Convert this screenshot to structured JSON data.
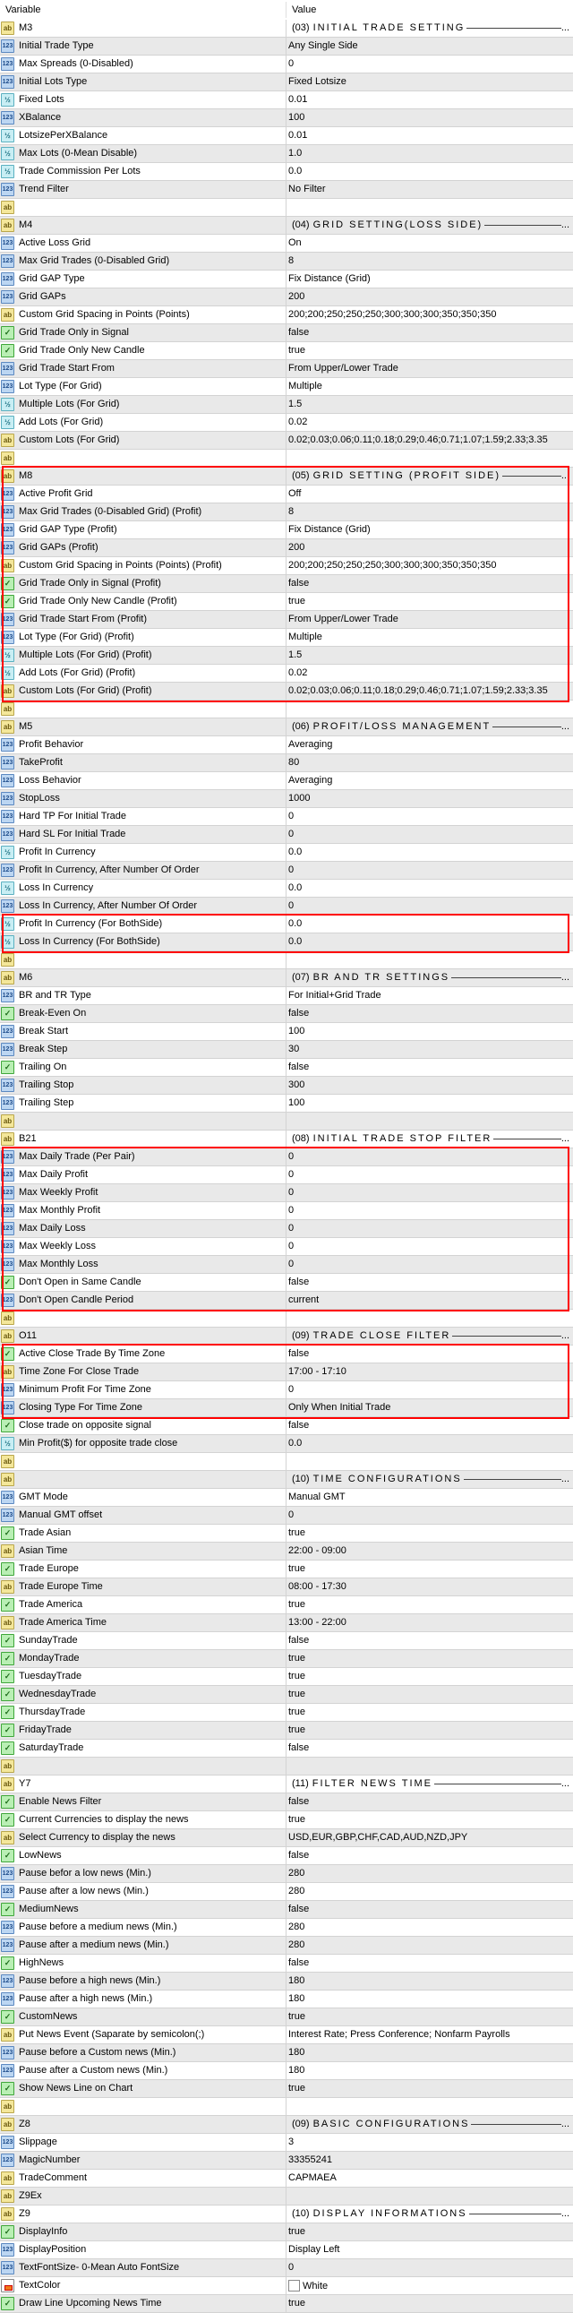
{
  "header": {
    "variable": "Variable",
    "value": "Value"
  },
  "rows": [
    {
      "t": "ab",
      "n": "M3",
      "code": "(03)",
      "title": "INITIAL TRADE SETTING"
    },
    {
      "t": "int",
      "n": "Initial Trade Type",
      "v": "Any Single Side"
    },
    {
      "t": "int",
      "n": "Max Spreads (0-Disabled)",
      "v": "0"
    },
    {
      "t": "int",
      "n": "Initial Lots Type",
      "v": "Fixed Lotsize"
    },
    {
      "t": "dbl",
      "n": "Fixed Lots",
      "v": "0.01"
    },
    {
      "t": "int",
      "n": "XBalance",
      "v": "100"
    },
    {
      "t": "dbl",
      "n": "LotsizePerXBalance",
      "v": "0.01"
    },
    {
      "t": "dbl",
      "n": "Max Lots (0-Mean Disable)",
      "v": "1.0"
    },
    {
      "t": "dbl",
      "n": "Trade Commission Per Lots",
      "v": "0.0"
    },
    {
      "t": "int",
      "n": "Trend Filter",
      "v": "No Filter"
    },
    {
      "t": "ab",
      "n": "",
      "v": ""
    },
    {
      "t": "ab",
      "n": "M4",
      "code": "(04)",
      "title": "GRID SETTING(LOSS SIDE)"
    },
    {
      "t": "int",
      "n": "Active Loss Grid",
      "v": "On"
    },
    {
      "t": "int",
      "n": "Max Grid Trades (0-Disabled Grid)",
      "v": "8"
    },
    {
      "t": "int",
      "n": "Grid GAP Type",
      "v": "Fix Distance (Grid)"
    },
    {
      "t": "int",
      "n": "Grid GAPs",
      "v": "200"
    },
    {
      "t": "ab",
      "n": "Custom Grid Spacing in Points (Points)",
      "v": "200;200;250;250;250;300;300;300;350;350;350"
    },
    {
      "t": "bool",
      "n": "Grid Trade Only in Signal",
      "v": "false"
    },
    {
      "t": "bool",
      "n": "Grid Trade Only New Candle",
      "v": "true"
    },
    {
      "t": "int",
      "n": "Grid Trade Start From",
      "v": "From Upper/Lower Trade"
    },
    {
      "t": "int",
      "n": "Lot Type (For Grid)",
      "v": "Multiple"
    },
    {
      "t": "dbl",
      "n": "Multiple Lots (For Grid)",
      "v": "1.5"
    },
    {
      "t": "dbl",
      "n": "Add Lots (For Grid)",
      "v": "0.02"
    },
    {
      "t": "ab",
      "n": "Custom Lots (For Grid)",
      "v": "0.02;0.03;0.06;0.11;0.18;0.29;0.46;0.71;1.07;1.59;2.33;3.35"
    },
    {
      "t": "ab",
      "n": "",
      "v": ""
    },
    {
      "t": "ab",
      "n": "M8",
      "code": "(05)",
      "title": "GRID SETTING (PROFIT SIDE)"
    },
    {
      "t": "int",
      "n": "Active Profit Grid",
      "v": "Off"
    },
    {
      "t": "int",
      "n": "Max Grid Trades (0-Disabled Grid) (Profit)",
      "v": "8"
    },
    {
      "t": "int",
      "n": "Grid GAP Type (Profit)",
      "v": "Fix Distance (Grid)"
    },
    {
      "t": "int",
      "n": "Grid GAPs (Profit)",
      "v": "200"
    },
    {
      "t": "ab",
      "n": "Custom Grid Spacing in Points (Points) (Profit)",
      "v": "200;200;250;250;250;300;300;300;350;350;350"
    },
    {
      "t": "bool",
      "n": "Grid Trade Only in Signal (Profit)",
      "v": "false"
    },
    {
      "t": "bool",
      "n": "Grid Trade Only New Candle (Profit)",
      "v": "true"
    },
    {
      "t": "int",
      "n": "Grid Trade Start From (Profit)",
      "v": "From Upper/Lower Trade"
    },
    {
      "t": "int",
      "n": "Lot Type (For Grid) (Profit)",
      "v": "Multiple"
    },
    {
      "t": "dbl",
      "n": "Multiple Lots (For Grid) (Profit)",
      "v": "1.5"
    },
    {
      "t": "dbl",
      "n": "Add Lots (For Grid) (Profit)",
      "v": "0.02"
    },
    {
      "t": "ab",
      "n": "Custom Lots (For Grid) (Profit)",
      "v": "0.02;0.03;0.06;0.11;0.18;0.29;0.46;0.71;1.07;1.59;2.33;3.35"
    },
    {
      "t": "ab",
      "n": "",
      "v": ""
    },
    {
      "t": "ab",
      "n": "M5",
      "code": "(06)",
      "title": "PROFIT/LOSS MANAGEMENT"
    },
    {
      "t": "int",
      "n": "Profit Behavior",
      "v": "Averaging"
    },
    {
      "t": "int",
      "n": "TakeProfit",
      "v": "80"
    },
    {
      "t": "int",
      "n": "Loss Behavior",
      "v": "Averaging"
    },
    {
      "t": "int",
      "n": "StopLoss",
      "v": "1000"
    },
    {
      "t": "int",
      "n": "Hard TP For Initial Trade",
      "v": "0"
    },
    {
      "t": "int",
      "n": "Hard SL For Initial Trade",
      "v": "0"
    },
    {
      "t": "dbl",
      "n": "Profit In Currency",
      "v": "0.0"
    },
    {
      "t": "int",
      "n": "Profit In Currency, After Number Of Order",
      "v": "0"
    },
    {
      "t": "dbl",
      "n": "Loss In Currency",
      "v": "0.0"
    },
    {
      "t": "int",
      "n": "Loss In Currency, After Number Of Order",
      "v": "0"
    },
    {
      "t": "dbl",
      "n": "Profit In Currency (For BothSide)",
      "v": "0.0"
    },
    {
      "t": "dbl",
      "n": "Loss In Currency (For BothSide)",
      "v": "0.0"
    },
    {
      "t": "ab",
      "n": "",
      "v": ""
    },
    {
      "t": "ab",
      "n": "M6",
      "code": "(07)",
      "title": "BR AND TR SETTINGS"
    },
    {
      "t": "int",
      "n": "BR and TR Type",
      "v": "For Initial+Grid Trade"
    },
    {
      "t": "bool",
      "n": "Break-Even On",
      "v": "false"
    },
    {
      "t": "int",
      "n": "Break Start",
      "v": "100"
    },
    {
      "t": "int",
      "n": "Break Step",
      "v": "30"
    },
    {
      "t": "bool",
      "n": "Trailing On",
      "v": "false"
    },
    {
      "t": "int",
      "n": "Trailing Stop",
      "v": "300"
    },
    {
      "t": "int",
      "n": "Trailing Step",
      "v": "100"
    },
    {
      "t": "ab",
      "n": "",
      "v": ""
    },
    {
      "t": "ab",
      "n": "B21",
      "code": "(08)",
      "title": "INITIAL TRADE STOP FILTER"
    },
    {
      "t": "int",
      "n": "Max Daily Trade (Per Pair)",
      "v": "0"
    },
    {
      "t": "int",
      "n": "Max Daily Profit",
      "v": "0"
    },
    {
      "t": "int",
      "n": "Max Weekly Profit",
      "v": "0"
    },
    {
      "t": "int",
      "n": "Max Monthly Profit",
      "v": "0"
    },
    {
      "t": "int",
      "n": "Max Daily Loss",
      "v": "0"
    },
    {
      "t": "int",
      "n": "Max Weekly Loss",
      "v": "0"
    },
    {
      "t": "int",
      "n": "Max Monthly Loss",
      "v": "0"
    },
    {
      "t": "bool",
      "n": "Don't Open in Same Candle",
      "v": "false"
    },
    {
      "t": "int",
      "n": "Don't Open Candle Period",
      "v": "current"
    },
    {
      "t": "ab",
      "n": "",
      "v": ""
    },
    {
      "t": "ab",
      "n": "O11",
      "code": "(09)",
      "title": "TRADE CLOSE FILTER"
    },
    {
      "t": "bool",
      "n": "Active Close Trade By Time Zone",
      "v": "false"
    },
    {
      "t": "ab",
      "n": "Time Zone For Close Trade",
      "v": "17:00 - 17:10"
    },
    {
      "t": "int",
      "n": "Minimum Profit For Time Zone",
      "v": "0"
    },
    {
      "t": "int",
      "n": "Closing Type For Time Zone",
      "v": "Only When Initial Trade"
    },
    {
      "t": "bool",
      "n": "Close trade on opposite signal",
      "v": "false"
    },
    {
      "t": "dbl",
      "n": "Min Profit($) for opposite trade close",
      "v": "0.0"
    },
    {
      "t": "ab",
      "n": "",
      "v": ""
    },
    {
      "t": "ab",
      "n": "",
      "code": "(10)",
      "title": "TIME CONFIGURATIONS"
    },
    {
      "t": "int",
      "n": "GMT Mode",
      "v": "Manual GMT"
    },
    {
      "t": "int",
      "n": "Manual GMT offset",
      "v": "0"
    },
    {
      "t": "bool",
      "n": "Trade Asian",
      "v": "true"
    },
    {
      "t": "ab",
      "n": "Asian Time",
      "v": "22:00 - 09:00"
    },
    {
      "t": "bool",
      "n": "Trade Europe",
      "v": "true"
    },
    {
      "t": "ab",
      "n": "Trade Europe Time",
      "v": "08:00 - 17:30"
    },
    {
      "t": "bool",
      "n": "Trade America",
      "v": "true"
    },
    {
      "t": "ab",
      "n": "Trade America Time",
      "v": "13:00 - 22:00"
    },
    {
      "t": "bool",
      "n": "SundayTrade",
      "v": "false"
    },
    {
      "t": "bool",
      "n": "MondayTrade",
      "v": "true"
    },
    {
      "t": "bool",
      "n": "TuesdayTrade",
      "v": "true"
    },
    {
      "t": "bool",
      "n": "WednesdayTrade",
      "v": "true"
    },
    {
      "t": "bool",
      "n": "ThursdayTrade",
      "v": "true"
    },
    {
      "t": "bool",
      "n": "FridayTrade",
      "v": "true"
    },
    {
      "t": "bool",
      "n": "SaturdayTrade",
      "v": "false"
    },
    {
      "t": "ab",
      "n": "",
      "v": ""
    },
    {
      "t": "ab",
      "n": "Y7",
      "code": "(11)",
      "title": "FILTER NEWS TIME"
    },
    {
      "t": "bool",
      "n": "Enable News Filter",
      "v": "false"
    },
    {
      "t": "bool",
      "n": "Current Currencies to display the news",
      "v": "true"
    },
    {
      "t": "ab",
      "n": "Select Currency to display the news",
      "v": "USD,EUR,GBP,CHF,CAD,AUD,NZD,JPY"
    },
    {
      "t": "bool",
      "n": "LowNews",
      "v": "false"
    },
    {
      "t": "int",
      "n": "Pause befor a low news (Min.)",
      "v": "280"
    },
    {
      "t": "int",
      "n": "Pause after a low news (Min.)",
      "v": "280"
    },
    {
      "t": "bool",
      "n": "MediumNews",
      "v": "false"
    },
    {
      "t": "int",
      "n": "Pause before a medium news (Min.)",
      "v": "280"
    },
    {
      "t": "int",
      "n": "Pause after a medium news (Min.)",
      "v": "280"
    },
    {
      "t": "bool",
      "n": "HighNews",
      "v": "false"
    },
    {
      "t": "int",
      "n": "Pause before a high news (Min.)",
      "v": "180"
    },
    {
      "t": "int",
      "n": "Pause after a high news (Min.)",
      "v": "180"
    },
    {
      "t": "bool",
      "n": "CustomNews",
      "v": "true"
    },
    {
      "t": "ab",
      "n": "Put News Event (Saparate by semicolon(;)",
      "v": "Interest Rate; Press Conference; Nonfarm Payrolls"
    },
    {
      "t": "int",
      "n": "Pause before a Custom news (Min.)",
      "v": "180"
    },
    {
      "t": "int",
      "n": "Pause after a Custom news (Min.)",
      "v": "180"
    },
    {
      "t": "bool",
      "n": "Show News Line on Chart",
      "v": "true"
    },
    {
      "t": "ab",
      "n": "",
      "v": ""
    },
    {
      "t": "ab",
      "n": "Z8",
      "code": "(09)",
      "title": "BASIC CONFIGURATIONS"
    },
    {
      "t": "int",
      "n": "Slippage",
      "v": "3"
    },
    {
      "t": "int",
      "n": "MagicNumber",
      "v": "33355241"
    },
    {
      "t": "ab",
      "n": "TradeComment",
      "v": "CAPMAEA"
    },
    {
      "t": "ab",
      "n": "Z9Ex",
      "v": ""
    },
    {
      "t": "ab",
      "n": "Z9",
      "code": "(10)",
      "title": "DISPLAY INFORMATIONS"
    },
    {
      "t": "bool",
      "n": "DisplayInfo",
      "v": "true"
    },
    {
      "t": "int",
      "n": "DisplayPosition",
      "v": "Display Left"
    },
    {
      "t": "int",
      "n": "TextFontSize- 0-Mean Auto FontSize",
      "v": "0"
    },
    {
      "t": "color",
      "n": "TextColor",
      "v": "White",
      "swatch": "#ffffff"
    },
    {
      "t": "bool",
      "n": "Draw Line Upcoming News Time",
      "v": "true"
    }
  ],
  "icon_glyphs": {
    "ab": "ab",
    "int": "123",
    "dbl": "½",
    "bool": "✓",
    "color": ""
  },
  "highlight_color": "#ff0000"
}
